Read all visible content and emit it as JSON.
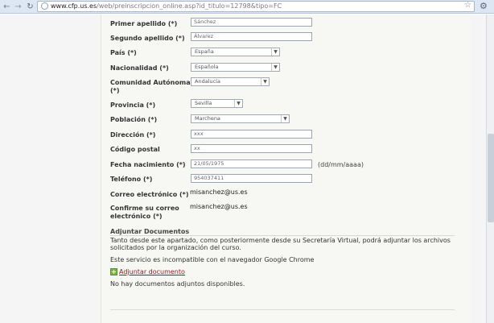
{
  "browser": {
    "url_host": "www.cfp.us.es",
    "url_path": "/web/preinscripcion_online.asp?id_titulo=12798&tipo=FC"
  },
  "form": {
    "primer_apellido": {
      "label": "Primer apellido (*)",
      "value": "Sánchez"
    },
    "segundo_apellido": {
      "label": "Segundo apellido (*)",
      "value": "Álvarez"
    },
    "pais": {
      "label": "País (*)",
      "value": "España"
    },
    "nacionalidad": {
      "label": "Nacionalidad (*)",
      "value": "Española"
    },
    "comunidad": {
      "label": "Comunidad Autónoma",
      "label_line2": "(*)",
      "value": "Andalucía"
    },
    "provincia": {
      "label": "Provincia (*)",
      "value": "Sevilla"
    },
    "poblacion": {
      "label": "Población (*)",
      "value": "Marchena"
    },
    "direccion": {
      "label": "Dirección (*)",
      "value": "xxx"
    },
    "codigo_postal": {
      "label": "Código postal",
      "value": "xx"
    },
    "fecha_nacimiento": {
      "label": "Fecha nacimiento (*)",
      "value": "21/05/1975",
      "hint": "(dd/mm/aaaa)"
    },
    "telefono": {
      "label": "Teléfono (*)",
      "value": "954037411"
    },
    "correo": {
      "label": "Correo electrónico (*)",
      "value": "misanchez@us.es"
    },
    "confirme_correo": {
      "label_line1": "Confirme su correo",
      "label_line2": "electrónico (*)",
      "value": "misanchez@us.es"
    }
  },
  "documents": {
    "title": "Adjuntar Documentos",
    "desc_line1": "Tanto desde este apartado, como posteriormente desde su Secretaría Virtual, podrá adjuntar los archivos",
    "desc_line2": "solicitados por la organización del curso.",
    "warning": "Este servicio es incompatible con el navegador Google Chrome",
    "add_link": "Adjuntar documento",
    "empty": "No hay documentos adjuntos disponibles."
  },
  "icons": {
    "back": "back-arrow-icon",
    "forward": "forward-arrow-icon",
    "reload": "reload-icon",
    "star": "star-icon",
    "wrench": "wrench-icon",
    "add": "add-document-icon"
  }
}
